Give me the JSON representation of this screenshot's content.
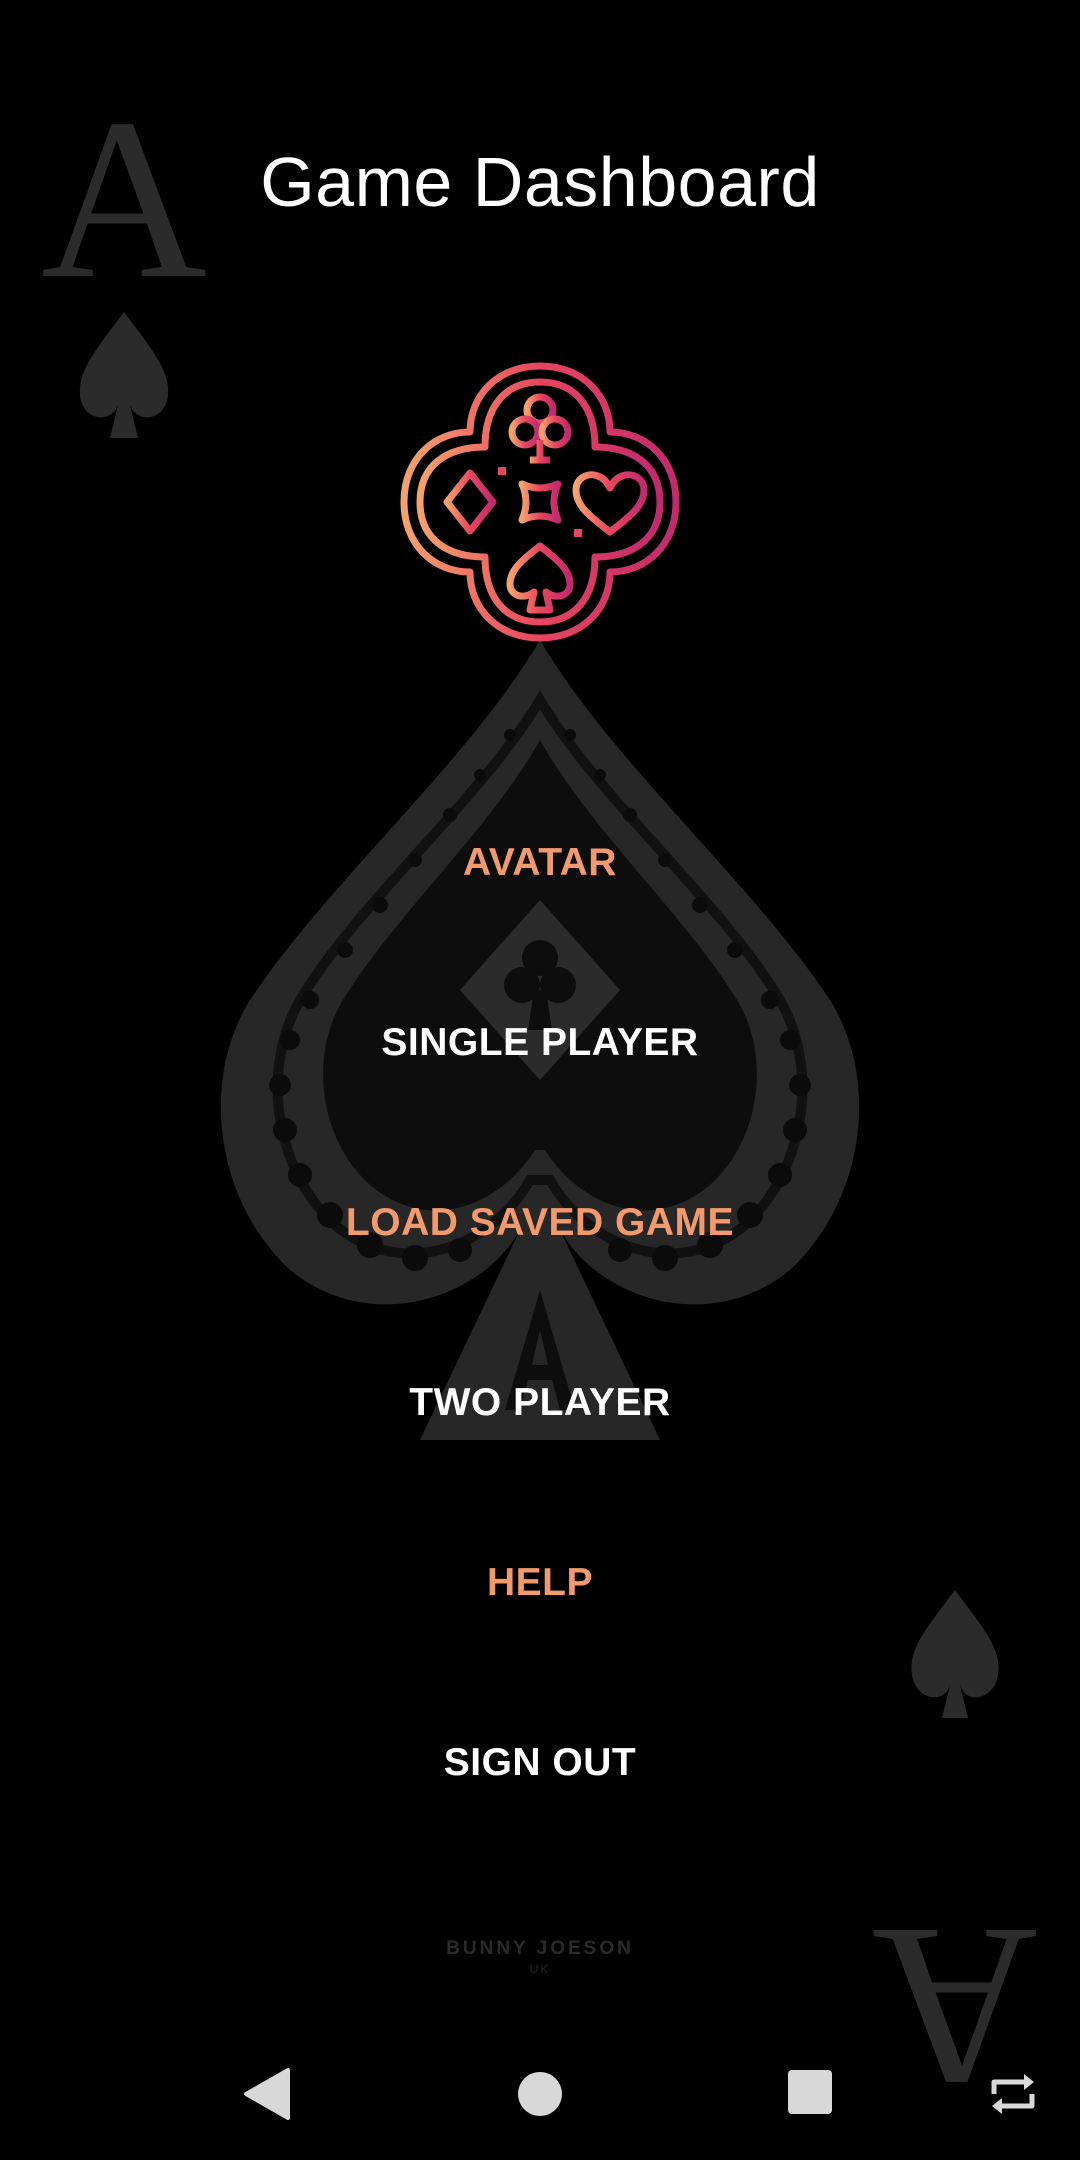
{
  "header": {
    "title": "Game Dashboard"
  },
  "menu": {
    "items": [
      {
        "label": "AVATAR",
        "color": "#F29A6B"
      },
      {
        "label": "SINGLE PLAYER",
        "color": "#FFFFFF"
      },
      {
        "label": "LOAD SAVED GAME",
        "color": "#F29A6B"
      },
      {
        "label": "TWO PLAYER",
        "color": "#FFFFFF"
      },
      {
        "label": "HELP",
        "color": "#F29A6B"
      },
      {
        "label": "SIGN OUT",
        "color": "#FFFFFF"
      }
    ]
  },
  "background": {
    "card_rank_top": "A",
    "card_rank_bottom": "A",
    "watermark": "BUNNY JOESON",
    "watermark_sub": "UK"
  },
  "logo": {
    "icon": "card-suits-logo",
    "gradient": [
      "#F5A26C",
      "#E8465E",
      "#C22A6E"
    ]
  },
  "navbar": {
    "icons": [
      "back-icon",
      "home-icon",
      "recents-icon",
      "rotate-icon"
    ],
    "color": "#D8D8D8"
  }
}
